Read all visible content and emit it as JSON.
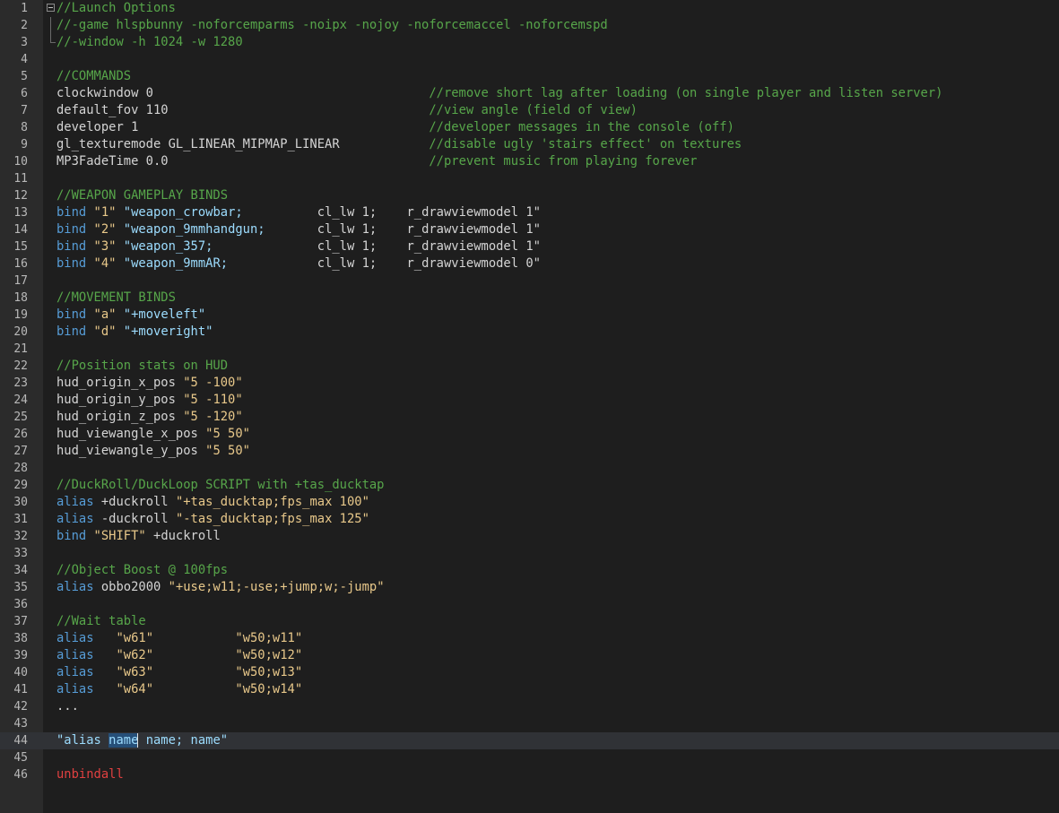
{
  "editor": {
    "lines": [
      "//Launch Options",
      "//-game hlspbunny -noforcemparms -noipx -nojoy -noforcemaccel -noforcemspd",
      "//-window -h 1024 -w 1280",
      "",
      "//COMMANDS",
      "clockwindow 0",
      "default_fov 110",
      "developer 1",
      "gl_texturemode GL_LINEAR_MIPMAP_LINEAR",
      "MP3FadeTime 0.0",
      "",
      "//WEAPON GAMEPLAY BINDS",
      "bind",
      "bind",
      "bind",
      "bind",
      "",
      "//MOVEMENT BINDS",
      "bind",
      "bind",
      "",
      "//Position stats on HUD",
      "hud_origin_x_pos",
      "hud_origin_y_pos",
      "hud_origin_z_pos",
      "hud_viewangle_x_pos",
      "hud_viewangle_y_pos",
      "",
      "//DuckRoll/DuckLoop SCRIPT with +tas_ducktap",
      "alias",
      "alias",
      "bind",
      "",
      "//Object Boost @ 100fps",
      "alias",
      "",
      "//Wait table",
      "alias",
      "alias",
      "alias",
      "alias",
      "...",
      "",
      "\"alias name name; name\"",
      "",
      "unbindall"
    ],
    "comments": {
      "l6": "//remove short lag after loading (on single player and listen server)",
      "l7": "//view angle (field of view)",
      "l8": "//developer messages in the console (off)",
      "l9": "//disable ugly 'stairs effect' on textures",
      "l10": "//prevent music from playing forever"
    },
    "binds": {
      "l13": {
        "key": "\"1\"",
        "cmd": "\"weapon_crowbar;",
        "a": "cl_lw 1;",
        "b": "r_drawviewmodel 1\""
      },
      "l14": {
        "key": "\"2\"",
        "cmd": "\"weapon_9mmhandgun;",
        "a": "cl_lw 1;",
        "b": "r_drawviewmodel 1\""
      },
      "l15": {
        "key": "\"3\"",
        "cmd": "\"weapon_357;",
        "a": "cl_lw 1;",
        "b": "r_drawviewmodel 1\""
      },
      "l16": {
        "key": "\"4\"",
        "cmd": "\"weapon_9mmAR;",
        "a": "cl_lw 1;",
        "b": "r_drawviewmodel 0\""
      },
      "l19": {
        "key": "\"a\"",
        "cmd": "\"+moveleft\""
      },
      "l20": {
        "key": "\"d\"",
        "cmd": "\"+moveright\""
      }
    },
    "hud_values": [
      "\"5 -100\"",
      "\"5 -110\"",
      "\"5 -120\"",
      "\"5 50\"",
      "\"5 50\""
    ],
    "duck": {
      "l30_name": "+duckroll",
      "l30_val": "\"+tas_ducktap;fps_max 100\"",
      "l31_name": "-duckroll",
      "l31_val": "\"-tas_ducktap;fps_max 125\"",
      "l32_key": "\"SHIFT\"",
      "l32_cmd": "+duckroll"
    },
    "boost": {
      "name": "obbo2000",
      "val": "\"+use;w11;-use;+jump;w;-jump\""
    },
    "wait": [
      {
        "name": "\"w61\"",
        "val": "\"w50;w11\""
      },
      {
        "name": "\"w62\"",
        "val": "\"w50;w12\""
      },
      {
        "name": "\"w63\"",
        "val": "\"w50;w13\""
      },
      {
        "name": "\"w64\"",
        "val": "\"w50;w14\""
      }
    ],
    "current_line": 44
  },
  "colors": {
    "background": "#1e1e1e",
    "gutter": "#2b2b2b",
    "comment": "#57a64a",
    "keyword": "#569cd6",
    "selection": "#264f78",
    "error": "#e04040"
  }
}
